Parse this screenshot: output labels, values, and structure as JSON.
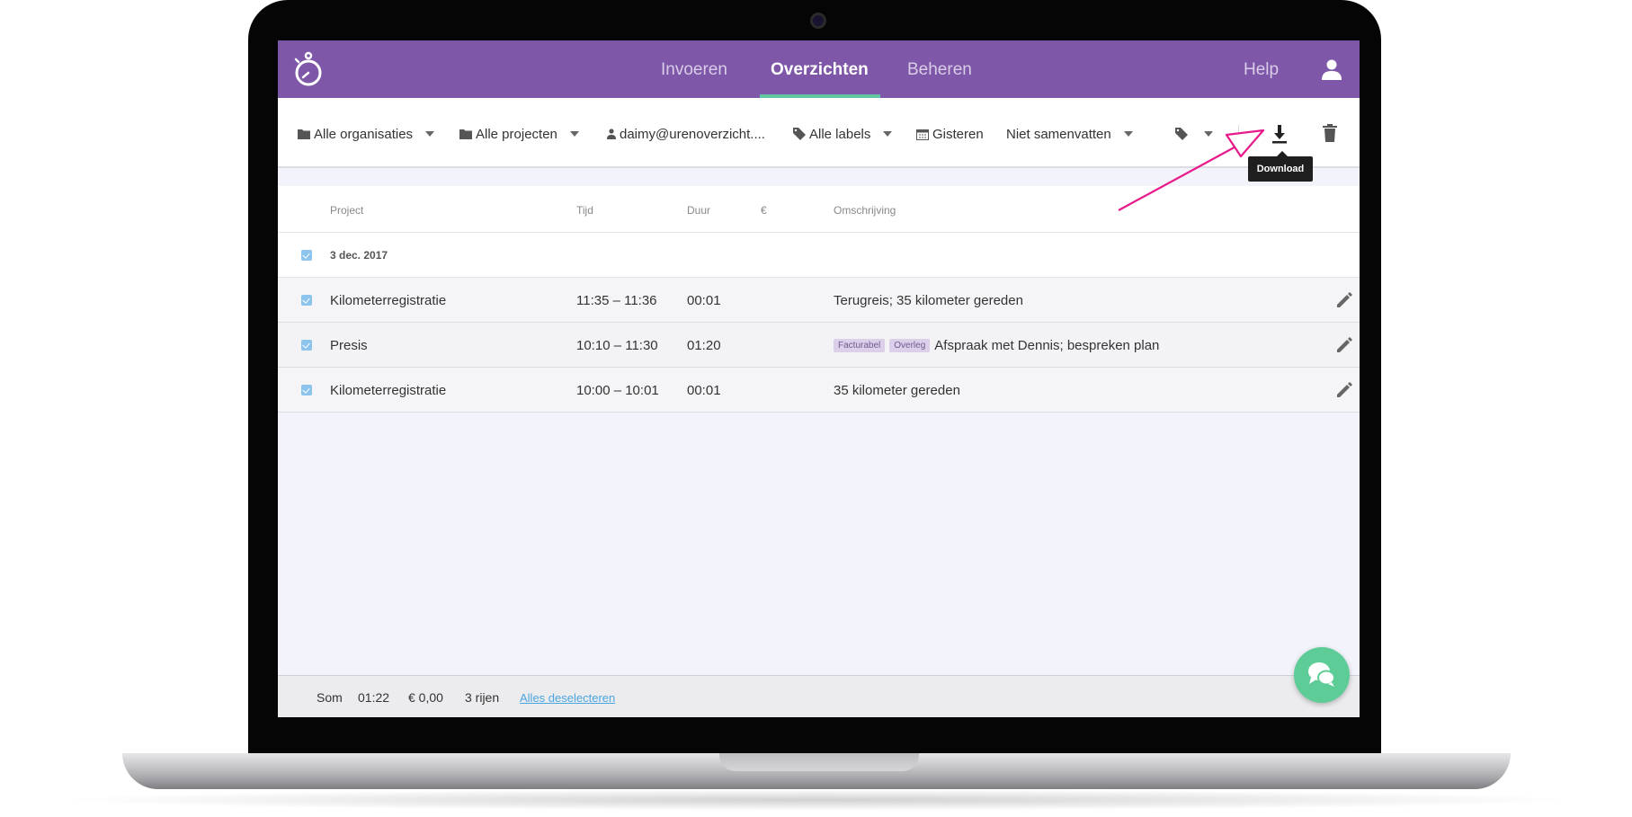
{
  "nav": {
    "tabs": [
      {
        "label": "Invoeren"
      },
      {
        "label": "Overzichten"
      },
      {
        "label": "Beheren"
      }
    ],
    "help": "Help"
  },
  "toolbar": {
    "organisations": "Alle organisaties",
    "projects": "Alle projecten",
    "user": "daimy@urenoverzicht....",
    "labels": "Alle labels",
    "date": "Gisteren",
    "summarize": "Niet samenvatten",
    "download_tooltip": "Download"
  },
  "table": {
    "headers": {
      "project": "Project",
      "time": "Tijd",
      "duration": "Duur",
      "euro": "€",
      "description": "Omschrijving"
    },
    "group": "3 dec. 2017",
    "rows": [
      {
        "project": "Kilometerregistratie",
        "time": "11:35 – 11:36",
        "duration": "00:01",
        "tags": [],
        "description": "Terugreis; 35 kilometer gereden"
      },
      {
        "project": "Presis",
        "time": "10:10 – 11:30",
        "duration": "01:20",
        "tags": [
          "Facturabel",
          "Overleg"
        ],
        "description": "Afspraak met Dennis; bespreken plan"
      },
      {
        "project": "Kilometerregistratie",
        "time": "10:00 – 10:01",
        "duration": "00:01",
        "tags": [],
        "description": "35 kilometer gereden"
      }
    ]
  },
  "footer": {
    "sum_label": "Som",
    "total_duration": "01:22",
    "total_amount": "€ 0,00",
    "row_count": "3 rijen",
    "deselect": "Alles deselecteren"
  },
  "colors": {
    "header": "#7e57a8",
    "accent": "#62c6a0",
    "checkbox": "#8cc4ee",
    "arrow": "#e8198b",
    "chat": "#5dcc96"
  },
  "icons": [
    "stopwatch-icon",
    "user-icon",
    "folder-icon",
    "tag-icon",
    "calendar-icon",
    "download-icon",
    "trash-icon",
    "pencil-icon",
    "chat-icon"
  ]
}
